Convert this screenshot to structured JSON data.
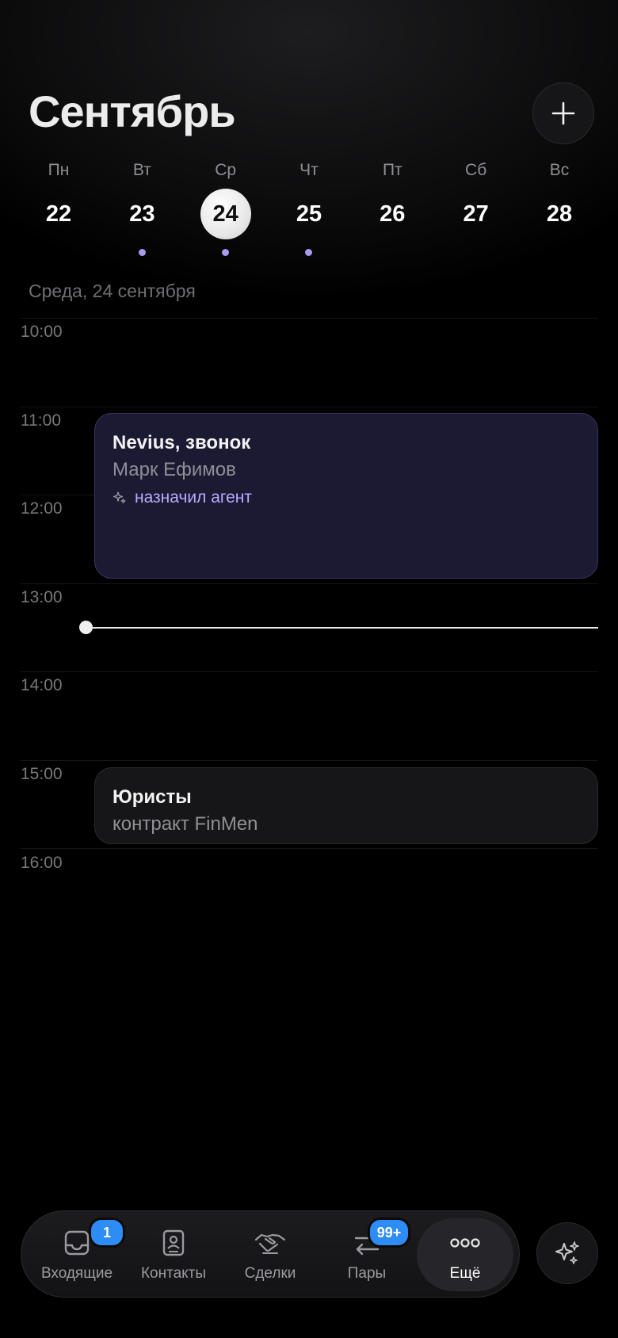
{
  "header": {
    "month_title": "Сентябрь"
  },
  "week": [
    {
      "name": "Пн",
      "num": "22",
      "selected": false,
      "has_events": false
    },
    {
      "name": "Вт",
      "num": "23",
      "selected": false,
      "has_events": true
    },
    {
      "name": "Ср",
      "num": "24",
      "selected": true,
      "has_events": true
    },
    {
      "name": "Чт",
      "num": "25",
      "selected": false,
      "has_events": true
    },
    {
      "name": "Пт",
      "num": "26",
      "selected": false,
      "has_events": false
    },
    {
      "name": "Сб",
      "num": "27",
      "selected": false,
      "has_events": false
    },
    {
      "name": "Вс",
      "num": "28",
      "selected": false,
      "has_events": false
    }
  ],
  "date_subtitle": "Среда, 24 сентября",
  "hours": [
    "10:00",
    "11:00",
    "12:00",
    "13:00",
    "14:00",
    "15:00",
    "16:00"
  ],
  "events": [
    {
      "title": "Nevius, звонок",
      "subtitle": "Марк Ефимов",
      "tag": "назначил агент"
    },
    {
      "title": "Юристы",
      "subtitle": "контракт FinMen"
    }
  ],
  "tabbar": {
    "inbox": {
      "label": "Входящие",
      "badge": "1"
    },
    "contacts": {
      "label": "Контакты"
    },
    "deals": {
      "label": "Сделки"
    },
    "pairs": {
      "label": "Пары",
      "badge": "99+"
    },
    "more": {
      "label": "Ещё"
    }
  },
  "colors": {
    "accent_purple": "#a79bf0",
    "badge_blue": "#2d8cf6",
    "event_bg": "#1c1933"
  },
  "icons": {
    "add": "plus-icon",
    "ai": "sparkles-icon",
    "inbox": "inbox-tray-icon",
    "contacts": "contact-card-icon",
    "deals": "handshake-icon",
    "pairs": "arrows-swap-icon",
    "more": "ellipsis-icon"
  }
}
